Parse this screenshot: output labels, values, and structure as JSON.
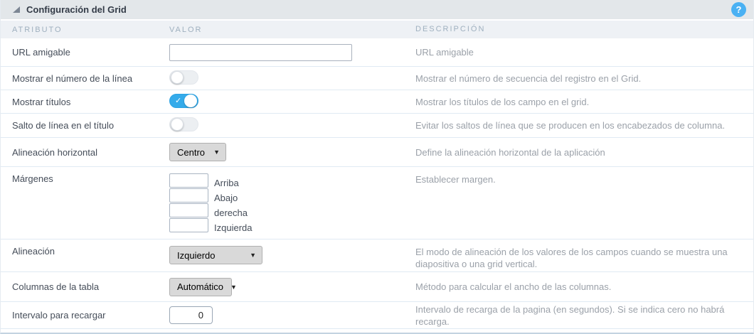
{
  "panel": {
    "title": "Configuración del Grid",
    "help_label": "?"
  },
  "columns": {
    "attribute": "ATRIBUTO",
    "value": "VALOR",
    "description": "DESCRIPCIÓN"
  },
  "colors": {
    "toggle_on_blue": "#35abea",
    "help_blue": "#4ab1f3",
    "titlebar_bg": "#e3e7ea",
    "colheader_bg": "#eef1f5",
    "row_border": "#e0eaf3"
  },
  "rows": {
    "url": {
      "label": "URL amigable",
      "value": "",
      "description": "URL amigable"
    },
    "line_number": {
      "label": "Mostrar el número de la línea",
      "state": "off",
      "description": "Mostrar el número de secuencia del registro en el Grid."
    },
    "show_titles": {
      "label": "Mostrar títulos",
      "state": "on",
      "check_glyph": "✓",
      "description": "Mostrar los títulos de los campo en el grid."
    },
    "title_line_break": {
      "label": "Salto de línea en el título",
      "state": "off",
      "description": "Evitar los saltos de línea que se producen en los encabezados de columna."
    },
    "horizontal_alignment": {
      "label": "Alineación horizontal",
      "selected": "Centro",
      "description": "Define la alineación horizontal de la aplicación"
    },
    "margins": {
      "label": "Márgenes",
      "description": "Establecer margen.",
      "fields": [
        {
          "label": "Arriba",
          "value": ""
        },
        {
          "label": "Abajo",
          "value": ""
        },
        {
          "label": "derecha",
          "value": ""
        },
        {
          "label": "Izquierda",
          "value": ""
        }
      ]
    },
    "alignment": {
      "label": "Alineación",
      "selected": "Izquierdo",
      "description": "El modo de alineación de los valores de los campos cuando se muestra una diapositiva o una grid vertical."
    },
    "table_columns": {
      "label": "Columnas de la tabla",
      "selected": "Automático",
      "description": "Método para calcular el ancho de las columnas."
    },
    "reload_interval": {
      "label": "Intervalo para recargar",
      "value": "0",
      "description": "Intervalo de recarga de la pagina (en segundos). Si se indica cero no habrá recarga."
    }
  }
}
